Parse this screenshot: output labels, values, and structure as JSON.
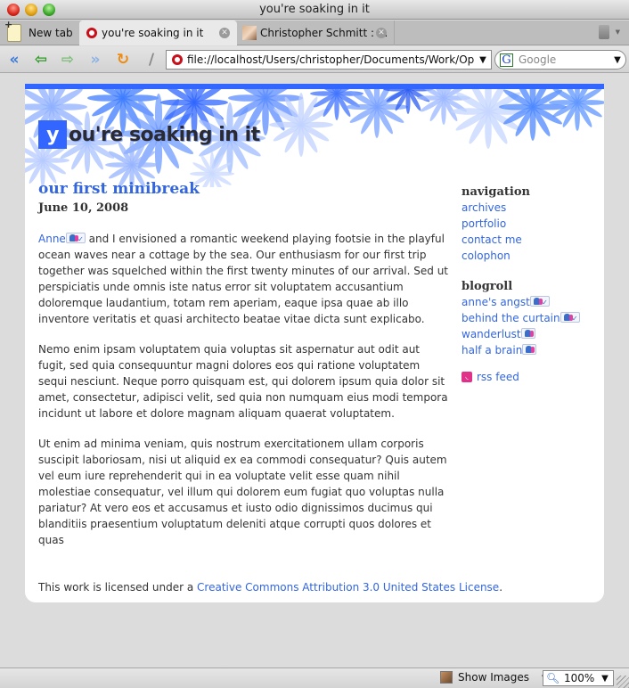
{
  "window": {
    "title": "you're soaking in it"
  },
  "tabs": {
    "new_tab_label": "New tab",
    "items": [
      {
        "label": "you're soaking in it",
        "active": true
      },
      {
        "label": "Christopher Schmitt : ...",
        "active": false
      }
    ]
  },
  "toolbar": {
    "url": "file://localhost/Users/christopher/Documents/Work/Op",
    "search_placeholder": "Google",
    "search_engine_glyph": "G"
  },
  "page": {
    "brand_color": "#3366ff",
    "link_color": "#3366dd",
    "site_title_initial": "y",
    "site_title_rest": "ou're soaking in it",
    "post": {
      "title": "our first minibreak",
      "date": "June 10, 2008",
      "first_link": "Anne",
      "paragraphs": [
        " and I envisioned a romantic weekend playing footsie in the playful ocean waves near a cottage by the sea. Our enthusiasm for our first trip together was squelched within the first twenty minutes of our arrival. Sed ut perspiciatis unde omnis iste natus error sit voluptatem accusantium doloremque laudantium, totam rem aperiam, eaque ipsa quae ab illo inventore veritatis et quasi architecto beatae vitae dicta sunt explicabo.",
        "Nemo enim ipsam voluptatem quia voluptas sit aspernatur aut odit aut fugit, sed quia consequuntur magni dolores eos qui ratione voluptatem sequi nesciunt. Neque porro quisquam est, qui dolorem ipsum quia dolor sit amet, consectetur, adipisci velit, sed quia non numquam eius modi tempora incidunt ut labore et dolore magnam aliquam quaerat voluptatem.",
        "Ut enim ad minima veniam, quis nostrum exercitationem ullam corporis suscipit laboriosam, nisi ut aliquid ex ea commodi consequatur? Quis autem vel eum iure reprehenderit qui in ea voluptate velit esse quam nihil molestiae consequatur, vel illum qui dolorem eum fugiat quo voluptas nulla pariatur? At vero eos et accusamus et iusto odio dignissimos ducimus qui blanditiis praesentium voluptatum deleniti atque corrupti quos dolores et quas"
      ]
    },
    "sidebar": {
      "navigation_heading": "navigation",
      "navigation": [
        "archives",
        "portfolio",
        "contact me",
        "colophon"
      ],
      "blogroll_heading": "blogroll",
      "blogroll": [
        {
          "label": "anne's angst",
          "xfn_check": true
        },
        {
          "label": "behind the curtain",
          "xfn_check": true
        },
        {
          "label": "wanderlust",
          "xfn_check": false
        },
        {
          "label": "half a brain",
          "xfn_check": false
        }
      ],
      "rss_label": "rss feed"
    },
    "footer": {
      "prefix": "This work is licensed under a ",
      "license_link": "Creative Commons Attribution 3.0 United States License",
      "suffix": "."
    }
  },
  "statusbar": {
    "show_images_label": "Show Images",
    "zoom_level": "100%"
  }
}
